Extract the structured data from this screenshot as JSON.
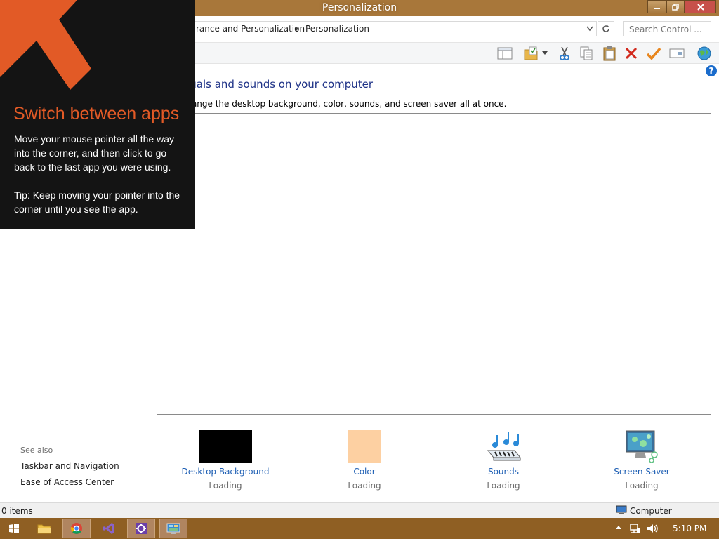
{
  "window": {
    "title": "Personalization",
    "controls": [
      "minimize",
      "maximize",
      "close"
    ],
    "accent_color": "#a8773a"
  },
  "address": {
    "crumbs": [
      "rance and Personalization",
      "Personalization"
    ],
    "search_placeholder": "Search Control ..."
  },
  "toolbar": {
    "icons": [
      "layout-pane-icon",
      "folder-check-icon",
      "cut-icon",
      "copy-icon",
      "paste-icon",
      "delete-icon",
      "checkmark-icon",
      "rename-icon",
      "globe-icon"
    ]
  },
  "main": {
    "heading": "the visuals and sounds on your computer",
    "subtext": "me to change the desktop background, color, sounds, and screen saver all at once."
  },
  "see_also": {
    "title": "See also",
    "links": [
      "Taskbar and Navigation",
      "Ease of Access Center"
    ]
  },
  "options": [
    {
      "label": "Desktop Background",
      "status": "Loading",
      "swatch": "#000000"
    },
    {
      "label": "Color",
      "status": "Loading",
      "swatch": "#fdd0a2"
    },
    {
      "label": "Sounds",
      "status": "Loading"
    },
    {
      "label": "Screen Saver",
      "status": "Loading"
    }
  ],
  "statusbar": {
    "items": "0 items",
    "location": "Computer"
  },
  "taskbar": {
    "apps": [
      "start",
      "file-explorer",
      "chrome",
      "visual-studio",
      "settings",
      "control-panel"
    ],
    "clock": "5:10 PM",
    "color": "#8f5f23"
  },
  "tip": {
    "title": "Switch between apps",
    "body": "Move your mouse pointer all the way into the corner, and then click to go back to the last app you were using.",
    "tip": "Tip: Keep moving your pointer into the corner until you see the app."
  }
}
